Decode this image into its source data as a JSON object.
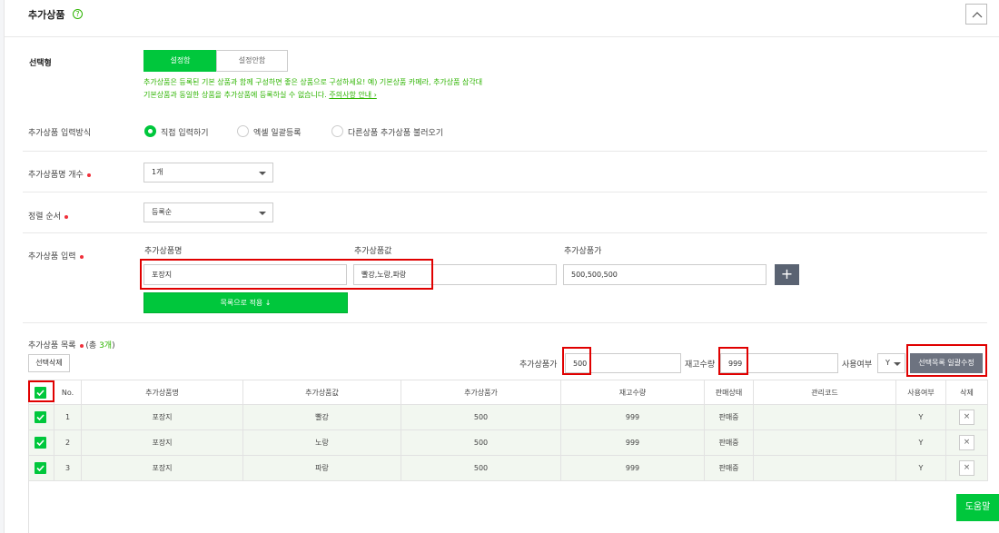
{
  "header": {
    "title": "추가상품",
    "help_icon": "?"
  },
  "setting": {
    "label": "선택형",
    "options": [
      "설정함",
      "설정안함"
    ],
    "note_line1": "추가상품은 등록된 기본 상품과 함께 구성하면 좋은 상품으로 구성하세요! 예) 기본상품 카메라, 추가상품 삼각대",
    "note_line2_prefix": "기본상품과 동일한 상품을 추가상품에 등록하실 수 없습니다.",
    "note_link": "주의사항 안내 ›"
  },
  "input_method": {
    "label": "추가상품 입력방식",
    "options": [
      "직접 입력하기",
      "엑셀 일괄등록",
      "다른상품 추가상품 불러오기"
    ],
    "selected": "직접 입력하기"
  },
  "name_count": {
    "label": "추가상품명 개수",
    "value": "1개"
  },
  "sort_order": {
    "label": "정렬 순서",
    "value": "등록순"
  },
  "product_input": {
    "label": "추가상품 입력",
    "col_name": "추가상품명",
    "col_value": "추가상품값",
    "col_price": "추가상품가",
    "name_value": "포장지",
    "value_value": "빨강,노랑,파랑",
    "price_value": "500,500,500",
    "plus": "+",
    "apply_btn": "목록으로 적용 ↓"
  },
  "list": {
    "label": "추가상품 목록",
    "count_prefix": "(총 ",
    "count": "3개",
    "count_suffix": ")",
    "delete_selected": "선택삭제",
    "bulk_price_label": "추가상품가",
    "bulk_price_value": "500",
    "bulk_stock_label": "재고수량",
    "bulk_stock_value": "999",
    "bulk_use_label": "사용여부",
    "bulk_use_value": "Y",
    "bulk_apply_btn": "선택목록 일괄수정",
    "columns": [
      "No.",
      "추가상품명",
      "추가상품값",
      "추가상품가",
      "재고수량",
      "판매상태",
      "관리코드",
      "사용여부",
      "삭제"
    ],
    "rows": [
      {
        "no": "1",
        "name": "포장지",
        "value": "빨강",
        "price": "500",
        "stock": "999",
        "status": "판매중",
        "code": "",
        "use": "Y",
        "del": "×"
      },
      {
        "no": "2",
        "name": "포장지",
        "value": "노랑",
        "price": "500",
        "stock": "999",
        "status": "판매중",
        "code": "",
        "use": "Y",
        "del": "×"
      },
      {
        "no": "3",
        "name": "포장지",
        "value": "파랑",
        "price": "500",
        "stock": "999",
        "status": "판매중",
        "code": "",
        "use": "Y",
        "del": "×"
      }
    ]
  },
  "help_button": "도움말",
  "colors": {
    "accent": "#00c73c",
    "highlight": "#e00000",
    "required": "#f0303b"
  }
}
